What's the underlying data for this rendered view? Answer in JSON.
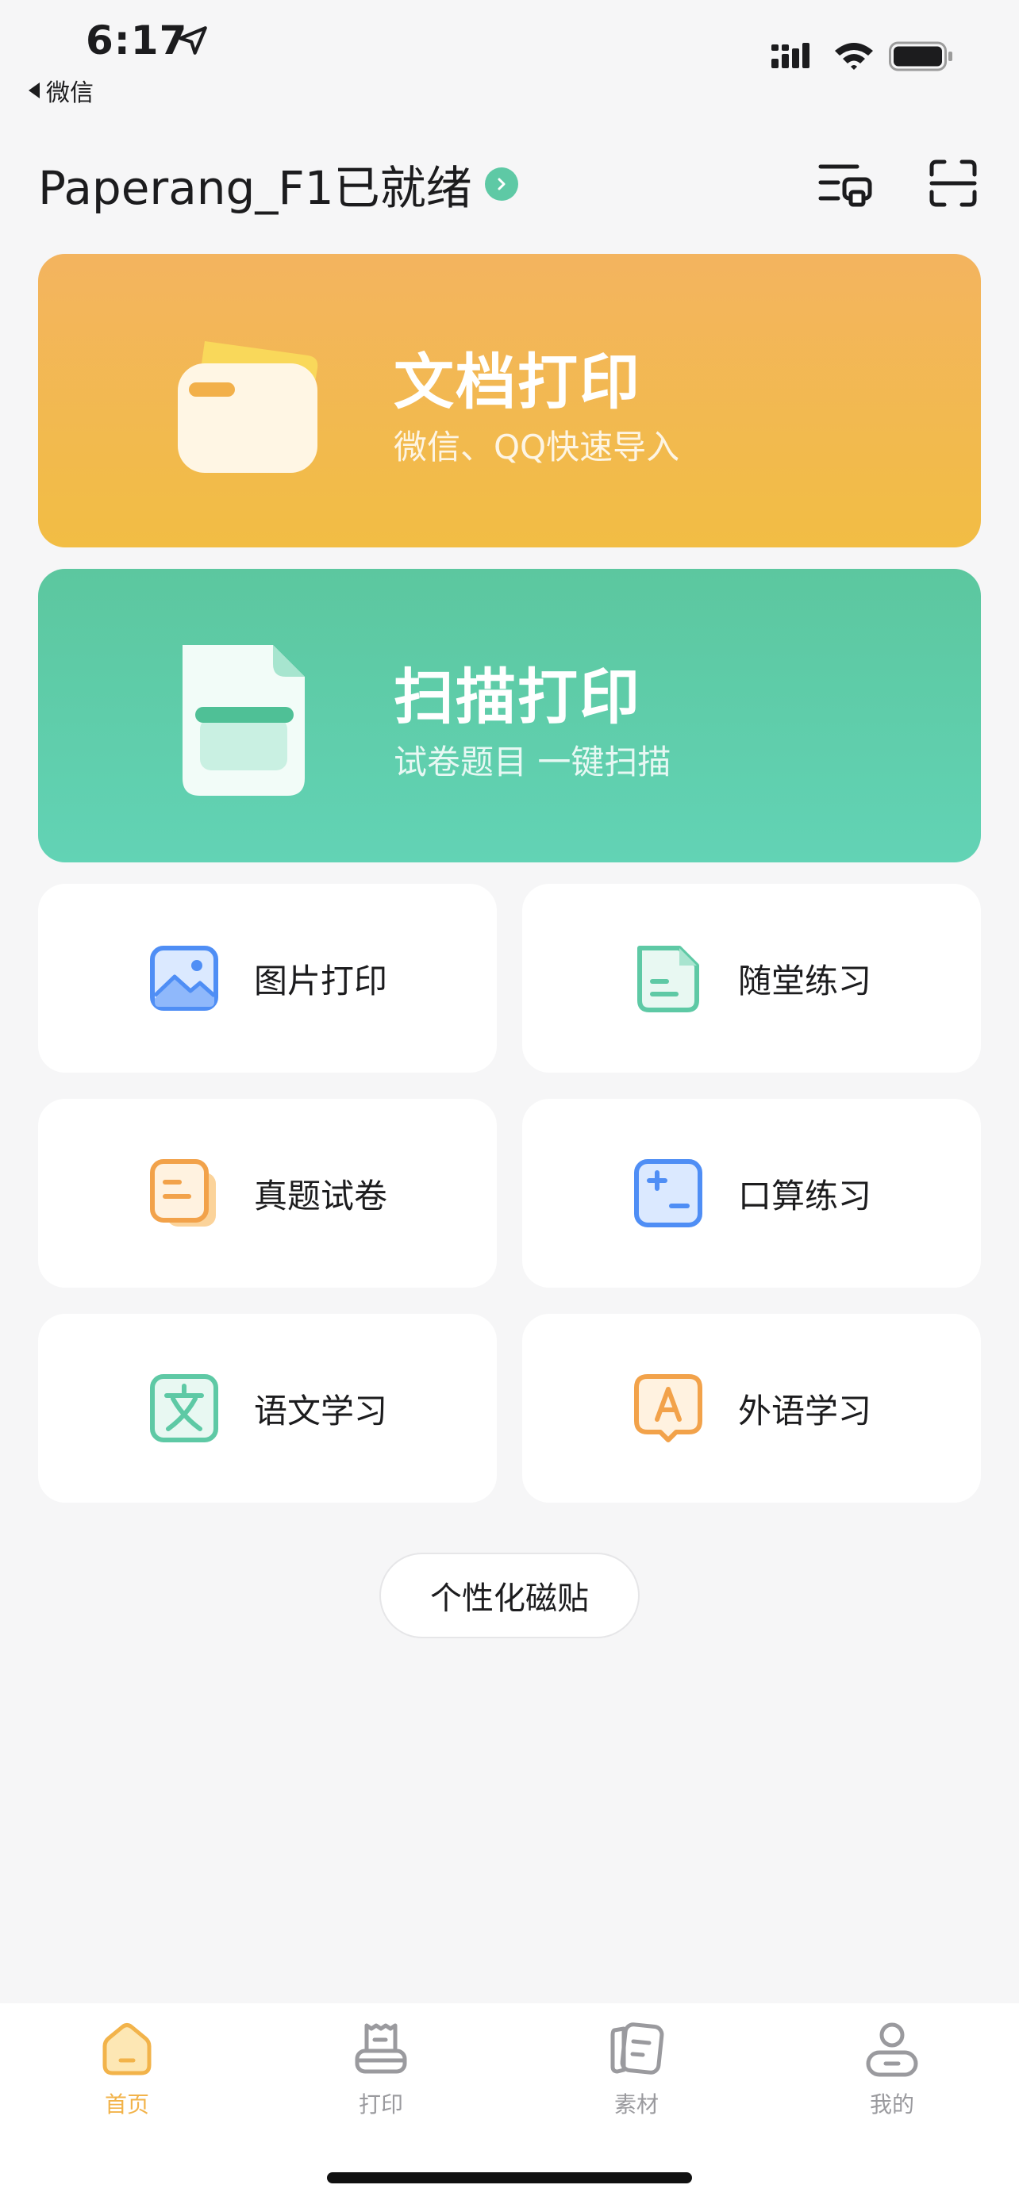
{
  "status_bar": {
    "time": "6:17",
    "back_app": "微信"
  },
  "header": {
    "device_title": "Paperang_F1已就绪",
    "icons": [
      "print-queue-icon",
      "scan-icon"
    ]
  },
  "cards": {
    "doc": {
      "title": "文档打印",
      "subtitle": "微信、QQ快速导入",
      "color": "#f2b851"
    },
    "scan": {
      "title": "扫描打印",
      "subtitle": "试卷题目  一键扫描",
      "color": "#5ecda9"
    }
  },
  "tiles": [
    {
      "label": "图片打印",
      "icon": "image-icon"
    },
    {
      "label": "随堂练习",
      "icon": "document-icon"
    },
    {
      "label": "真题试卷",
      "icon": "exam-paper-icon"
    },
    {
      "label": "口算练习",
      "icon": "calculator-icon"
    },
    {
      "label": "语文学习",
      "icon": "chinese-char-icon"
    },
    {
      "label": "外语学习",
      "icon": "foreign-language-icon"
    }
  ],
  "customize_button": "个性化磁贴",
  "tabbar": {
    "items": [
      {
        "label": "首页",
        "icon": "home-icon",
        "active": true
      },
      {
        "label": "打印",
        "icon": "printer-icon",
        "active": false
      },
      {
        "label": "素材",
        "icon": "materials-icon",
        "active": false
      },
      {
        "label": "我的",
        "icon": "profile-icon",
        "active": false
      }
    ],
    "active_color": "#f2b34a"
  }
}
